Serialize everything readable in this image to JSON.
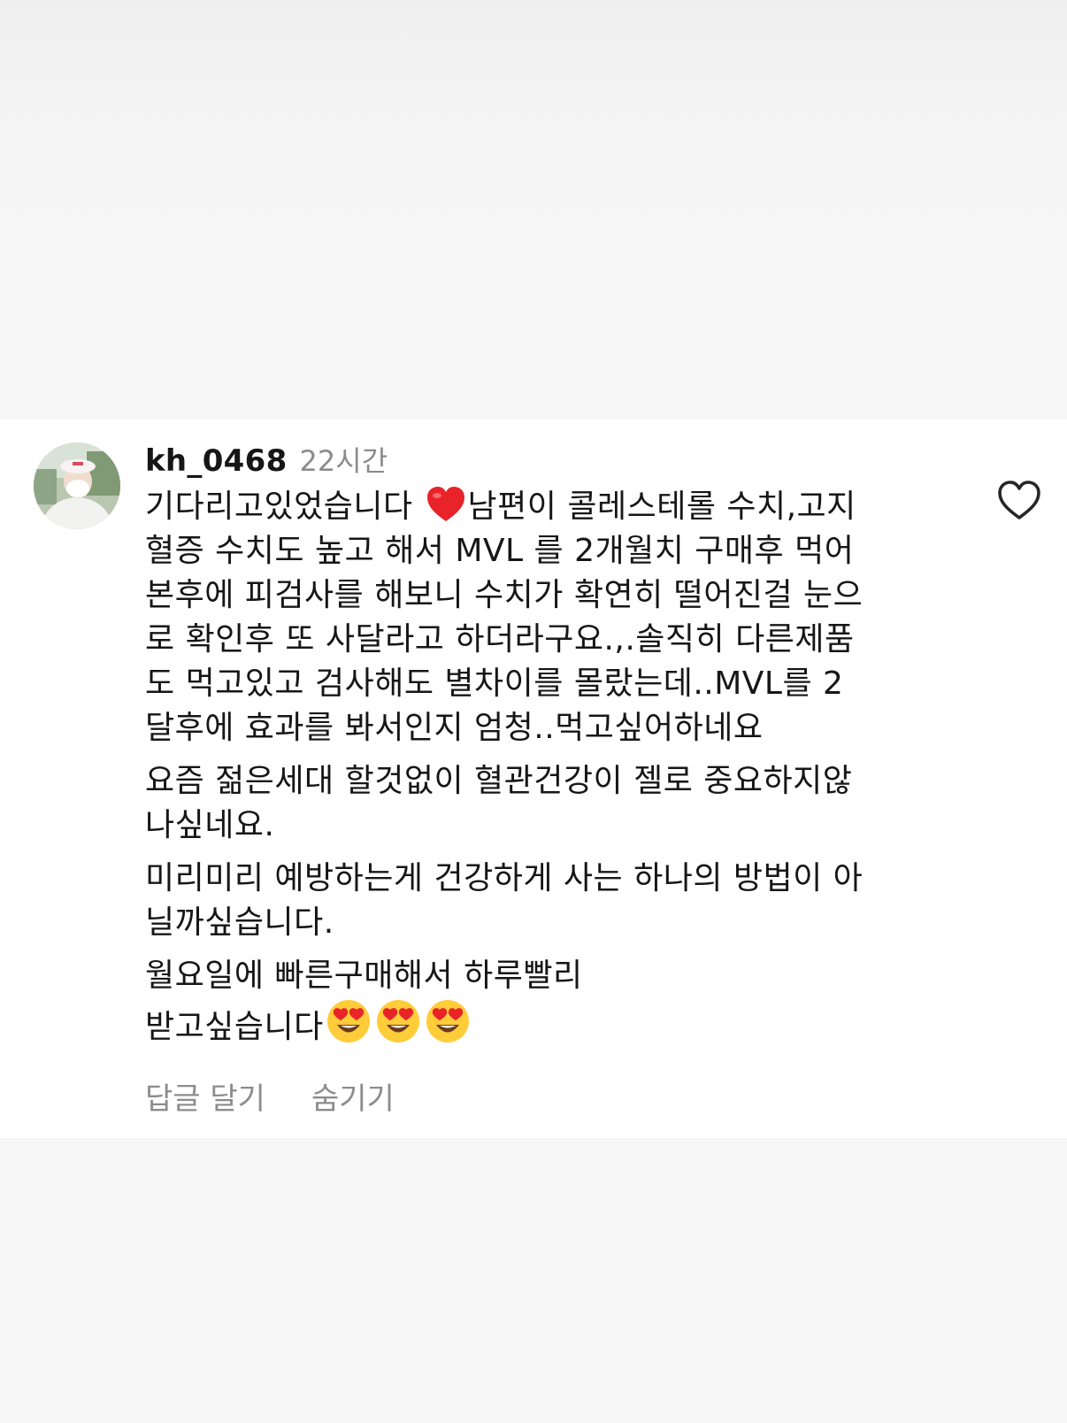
{
  "comment": {
    "username": "kh_0468",
    "timestamp": "22시간",
    "paragraphs": [
      {
        "lines": [
          {
            "before": "기다리고있었습니다 ",
            "emoji": "heart-emoji",
            "after": "남편이 콜레스테롤 수치,고지"
          },
          {
            "text": "혈증 수치도 높고 해서 MVL 를 2개월치 구매후 먹어"
          },
          {
            "text": "본후에 피검사를 해보니 수치가 확연히 떨어진걸 눈으"
          },
          {
            "text": "로 확인후 또 사달라고 하더라구요.,.솔직히 다른제품"
          },
          {
            "text": "도 먹고있고 검사해도 별차이를 몰랐는데..MVL를 2"
          },
          {
            "text": "달후에 효과를 봐서인지 엄청..먹고싶어하네요"
          }
        ]
      },
      {
        "lines": [
          {
            "text": "요즘 젊은세대 할것없이 혈관건강이 젤로 중요하지않"
          },
          {
            "text": "나싶네요."
          }
        ]
      },
      {
        "lines": [
          {
            "text": "미리미리 예방하는게 건강하게 사는 하나의 방법이 아"
          },
          {
            "text": "닐까싶습니다."
          }
        ]
      },
      {
        "lines": [
          {
            "text": "월요일에 빠른구매해서 하루빨리"
          },
          {
            "text": "받고싶습니다",
            "emojis": [
              "heart-eyes-emoji",
              "heart-eyes-emoji",
              "heart-eyes-emoji"
            ]
          }
        ]
      }
    ],
    "actions": {
      "reply": "답글 달기",
      "hide": "숨기기"
    },
    "like_icon": "heart-outline-icon",
    "colors": {
      "text": "#161616",
      "muted": "#8c8c8c",
      "heart": "#e8232a",
      "emoji_face": "#ffcc3a"
    }
  }
}
